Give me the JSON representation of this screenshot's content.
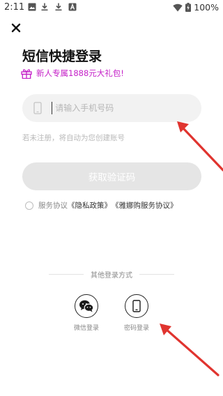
{
  "status_bar": {
    "time": "2:11",
    "battery": "100%",
    "icons": [
      "image-icon",
      "download-icon",
      "download-icon",
      "app-notification-icon",
      "wifi-icon",
      "battery-charging-icon"
    ]
  },
  "header": {
    "title": "短信快捷登录"
  },
  "promo": {
    "text": "新人专属1888元大礼包!"
  },
  "phone_field": {
    "placeholder": "请输入手机号码",
    "value": ""
  },
  "hint": "若未注册，将自动为您创建账号",
  "code_button": {
    "label": "获取验证码"
  },
  "agreement": {
    "prefix": "服务协议",
    "privacy": "《隐私政策》",
    "service": "《雅娜购服务协议》"
  },
  "other_login": {
    "title": "其他登录方式",
    "options": [
      {
        "label": "微信登录",
        "icon": "wechat-icon"
      },
      {
        "label": "密码登录",
        "icon": "phone-icon"
      }
    ]
  },
  "colors": {
    "promo": "#c41fc7",
    "annotation_arrow": "#e0342f",
    "disabled_button": "#e5e5e5",
    "input_bg": "#f2f2f2"
  }
}
